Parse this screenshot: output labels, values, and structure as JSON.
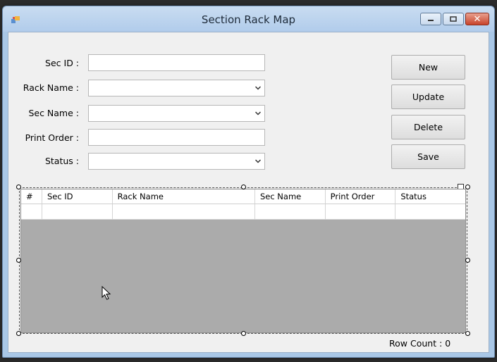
{
  "window": {
    "title": "Section Rack Map"
  },
  "form": {
    "sec_id": {
      "label": "Sec ID :",
      "value": ""
    },
    "rack_name": {
      "label": "Rack Name :",
      "value": ""
    },
    "sec_name": {
      "label": "Sec Name :",
      "value": ""
    },
    "print_order": {
      "label": "Print Order :",
      "value": ""
    },
    "status": {
      "label": "Status :",
      "value": ""
    }
  },
  "buttons": {
    "new": "New",
    "update": "Update",
    "delete": "Delete",
    "save": "Save"
  },
  "grid": {
    "columns": [
      "#",
      "Sec ID",
      "Rack Name",
      "Sec Name",
      "Print Order",
      "Status"
    ],
    "rows": [
      [
        "",
        "",
        "",
        "",
        "",
        ""
      ]
    ]
  },
  "footer": {
    "row_count": "Row Count : 0"
  },
  "colors": {
    "titlebar": "#b8d1ee",
    "client": "#f0f0f0",
    "grid_bg": "#ababab",
    "close": "#c8442b"
  }
}
